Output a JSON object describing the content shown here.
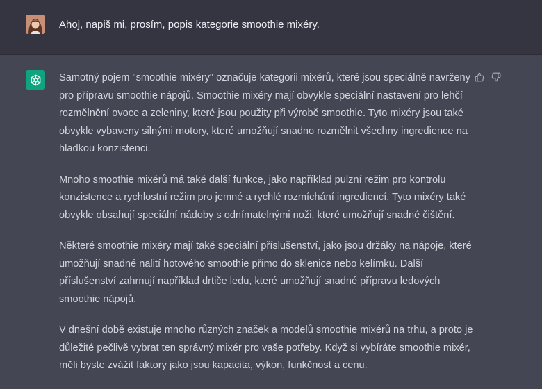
{
  "user": {
    "message": "Ahoj, napiš mi, prosím, popis kategorie smoothie mixéry."
  },
  "assistant": {
    "paragraphs": [
      [
        "Samotný pojem \"smoothie mixéry\" označuje kategorii mixérů, které jsou speciálně navrženy",
        "pro přípravu smoothie nápojů. Smoothie mixéry mají obvykle speciální nastavení pro lehčí",
        "rozmělnění ovoce a zeleniny, které jsou použity při výrobě smoothie. Tyto mixéry jsou také",
        "obvykle vybaveny silnými motory, které umožňují snadno rozmělnit všechny ingredience na",
        "hladkou konzistenci."
      ],
      [
        "Mnoho smoothie mixérů má také další funkce, jako například pulzní režim pro kontrolu",
        "konzistence a rychlostní režim pro jemné a rychlé rozmíchání ingrediencí. Tyto mixéry také",
        "obvykle obsahují speciální nádoby s odnímatelnými noži, které umožňují snadné čištění."
      ],
      [
        "Některé smoothie mixéry mají také speciální příslušenství, jako jsou držáky na nápoje, které",
        "umožňují snadné nalití hotového smoothie přímo do sklenice nebo kelímku. Další",
        "příslušenství zahrnují například drtiče ledu, které umožňují snadné přípravu ledových",
        "smoothie nápojů."
      ],
      [
        "V dnešní době existuje mnoho různých značek a modelů smoothie mixérů na trhu, a proto je",
        "důležité pečlivě vybrat ten správný mixér pro vaše potřeby. Když si vybíráte smoothie mixér,",
        "měli byste zvážit faktory jako jsou kapacita, výkon, funkčnost a cenu."
      ]
    ]
  },
  "icons": {
    "user_avatar": "user-avatar",
    "assistant_avatar": "openai-logo-icon",
    "thumbs_up": "thumbs-up-icon",
    "thumbs_down": "thumbs-down-icon"
  },
  "colors": {
    "user_bg": "#343541",
    "assistant_bg": "#444654",
    "accent": "#10a37f"
  }
}
